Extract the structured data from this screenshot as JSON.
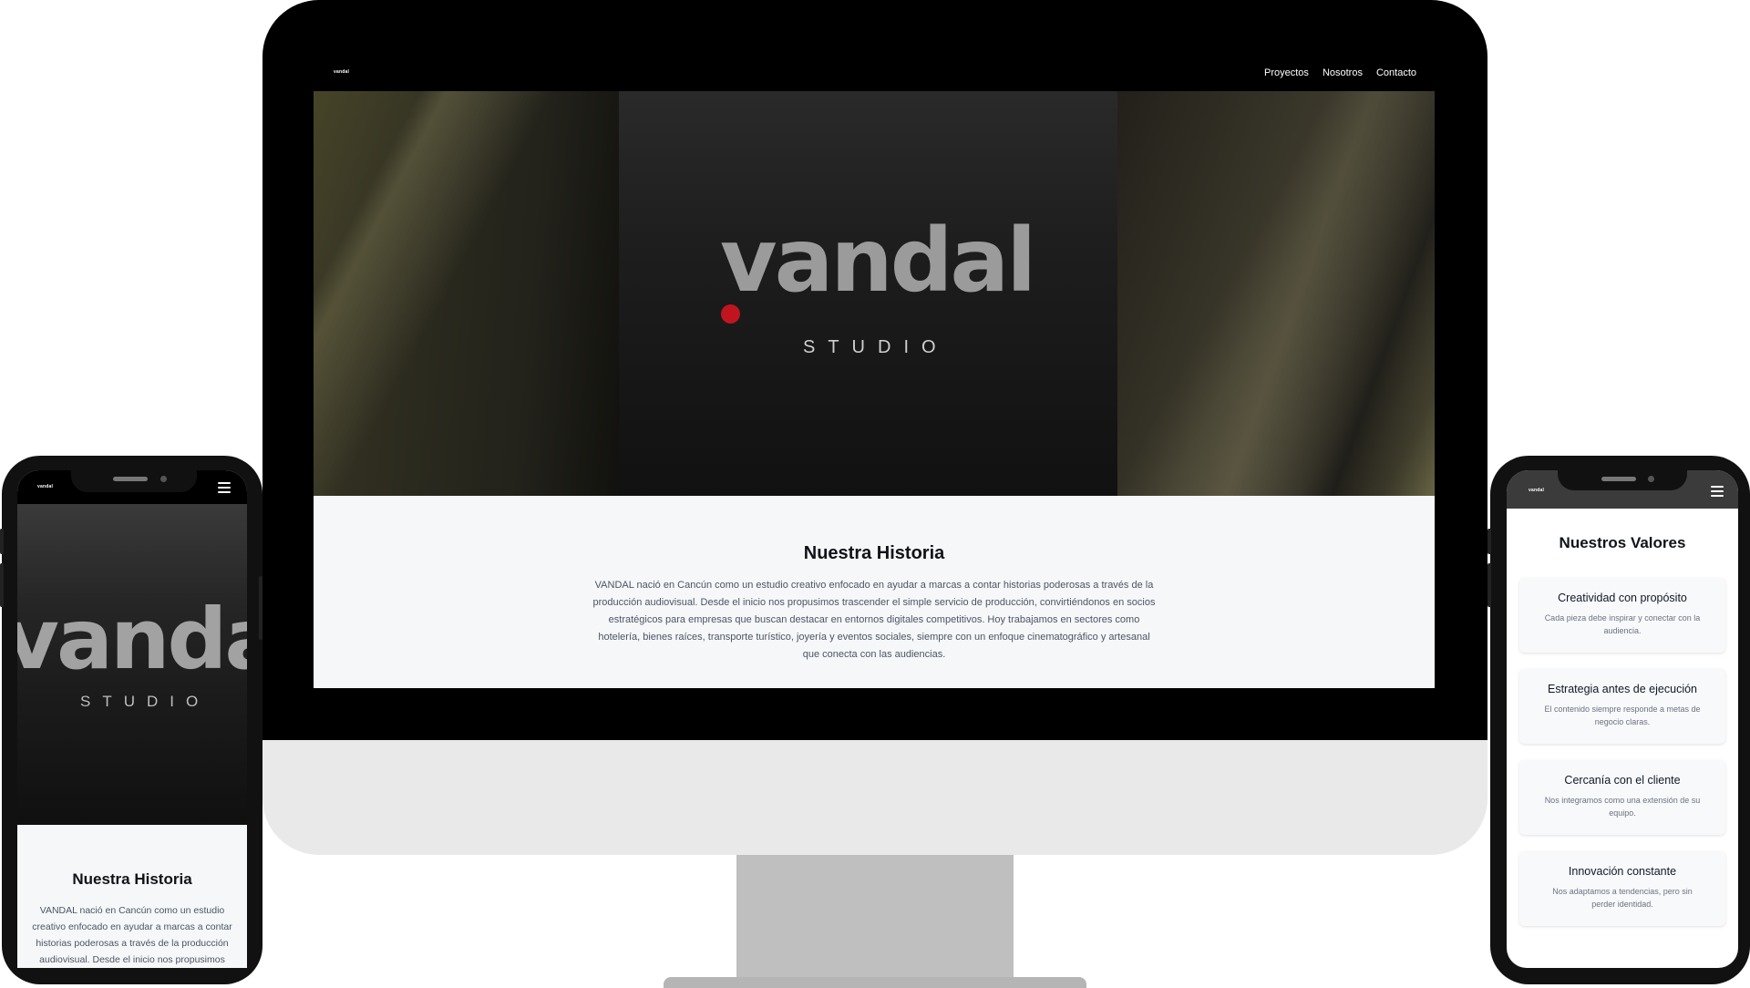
{
  "desktop": {
    "logo_small": "vandal",
    "nav": [
      "Proyectos",
      "Nosotros",
      "Contacto"
    ],
    "hero": {
      "logo": "vandal",
      "subtitle": "STUDIO"
    },
    "section": {
      "title": "Nuestra Historia",
      "paragraph": "VANDAL nació en Cancún como un estudio creativo enfocado en ayudar a marcas a contar historias poderosas a través de la producción audiovisual. Desde el inicio nos propusimos trascender el simple servicio de producción, convirtiéndonos en socios estratégicos para empresas que buscan destacar en entornos digitales competitivos. Hoy trabajamos en sectores como hotelería, bienes raíces, transporte turístico, joyería y eventos sociales, siempre con un enfoque cinematográfico y artesanal que conecta con las audiencias."
    }
  },
  "phone_left": {
    "logo_small": "vandal",
    "menu_icon": "hamburger-icon",
    "hero": {
      "logo": "vandal",
      "subtitle": "STUDIO"
    },
    "section": {
      "title": "Nuestra Historia",
      "paragraph": "VANDAL nació en Cancún como un estudio creativo enfocado en ayudar a marcas a contar historias poderosas a través de la producción audiovisual. Desde el inicio nos propusimos"
    }
  },
  "phone_right": {
    "logo_small": "vandal",
    "menu_icon": "hamburger-icon",
    "section_title": "Nuestros Valores",
    "values": [
      {
        "title": "Creatividad con propósito",
        "text": "Cada pieza debe inspirar y conectar con la audiencia."
      },
      {
        "title": "Estrategia antes de ejecución",
        "text": "El contenido siempre responde a metas de negocio claras."
      },
      {
        "title": "Cercanía con el cliente",
        "text": "Nos integramos como una extensión de su equipo."
      },
      {
        "title": "Innovación constante",
        "text": "Nos adaptamos a tendencias, pero sin perder identidad."
      }
    ]
  },
  "colors": {
    "accent": "#c0151f",
    "nav_bg": "#000000",
    "content_bg": "#f6f7f9",
    "heading": "#101418"
  }
}
